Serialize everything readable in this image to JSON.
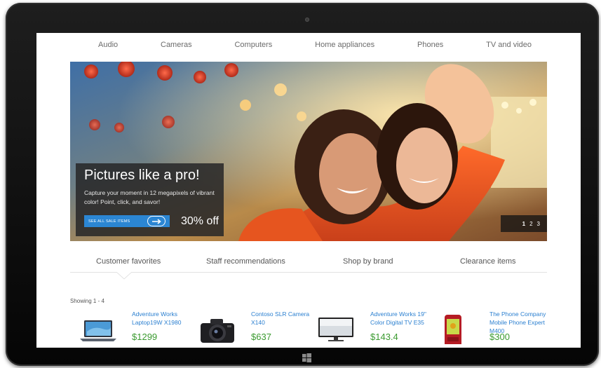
{
  "nav": {
    "categories": [
      "Audio",
      "Cameras",
      "Computers",
      "Home appliances",
      "Phones",
      "TV and video"
    ]
  },
  "hero": {
    "title": "Pictures like a pro!",
    "body": "Capture your moment in 12 megapixels of vibrant color! Point, click, and savor!",
    "cta_label": "SEE ALL SALE ITEMS",
    "offer": "30% off",
    "pages": [
      "1",
      "2",
      "3"
    ],
    "active_page": 0
  },
  "tabs": {
    "items": [
      "Customer favorites",
      "Staff recommendations",
      "Shop by brand",
      "Clearance items"
    ],
    "selected": 0
  },
  "results": {
    "showing": "Showing 1 - 4"
  },
  "products": [
    {
      "name": "Adventure Works Laptop19W X1980",
      "price": "$1299",
      "icon": "laptop-icon"
    },
    {
      "name": "Contoso SLR Camera X140",
      "price": "$637",
      "icon": "camera-icon"
    },
    {
      "name": "Adventure Works 19\" Color Digital TV E35",
      "price": "$143.4",
      "icon": "tv-icon"
    },
    {
      "name": "The Phone Company Mobile Phone Expert M400",
      "price": "$300",
      "icon": "phone-icon"
    }
  ],
  "colors": {
    "link": "#2a7fd0",
    "price": "#3a9a2f",
    "cta": "#2b86d3",
    "bezel": "#111111"
  }
}
